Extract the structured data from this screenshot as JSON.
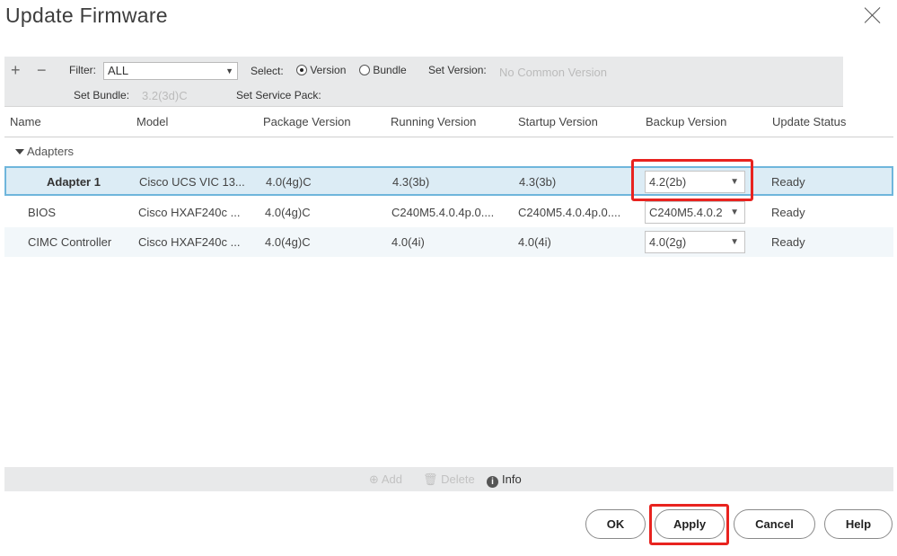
{
  "dialog": {
    "title": "Update Firmware"
  },
  "toolbar": {
    "add_symbol": "+",
    "remove_symbol": "−",
    "filter_label": "Filter:",
    "filter_value": "ALL",
    "select_label": "Select:",
    "select_options": [
      "Version",
      "Bundle"
    ],
    "select_checked": "Version",
    "set_version_label": "Set Version:",
    "set_version_value": "No Common Version",
    "set_bundle_label": "Set Bundle:",
    "set_bundle_value": "3.2(3d)C",
    "set_service_pack_label": "Set Service Pack:"
  },
  "table": {
    "headers": [
      "Name",
      "Model",
      "Package Version",
      "Running Version",
      "Startup Version",
      "Backup Version",
      "Update Status"
    ],
    "group": "Adapters",
    "rows": [
      {
        "name": "Adapter 1",
        "model": "Cisco UCS VIC 13...",
        "package": "4.0(4g)C",
        "running": "4.3(3b)",
        "startup": "4.3(3b)",
        "backup": "4.2(2b)",
        "status": "Ready"
      },
      {
        "name": "BIOS",
        "model": "Cisco HXAF240c ...",
        "package": "4.0(4g)C",
        "running": "C240M5.4.0.4p.0....",
        "startup": "C240M5.4.0.4p.0....",
        "backup": "C240M5.4.0.2",
        "status": "Ready"
      },
      {
        "name": "CIMC Controller",
        "model": "Cisco HXAF240c ...",
        "package": "4.0(4g)C",
        "running": "4.0(4i)",
        "startup": "4.0(4i)",
        "backup": "4.0(2g)",
        "status": "Ready"
      }
    ]
  },
  "bottom_bar": {
    "add_label": "Add",
    "delete_label": "Delete",
    "info_label": "Info"
  },
  "buttons": {
    "ok": "OK",
    "apply": "Apply",
    "cancel": "Cancel",
    "help": "Help"
  },
  "colors": {
    "highlight": "#e8231f",
    "selected_row": "#dcecf5",
    "selected_border": "#6fb6dc"
  }
}
